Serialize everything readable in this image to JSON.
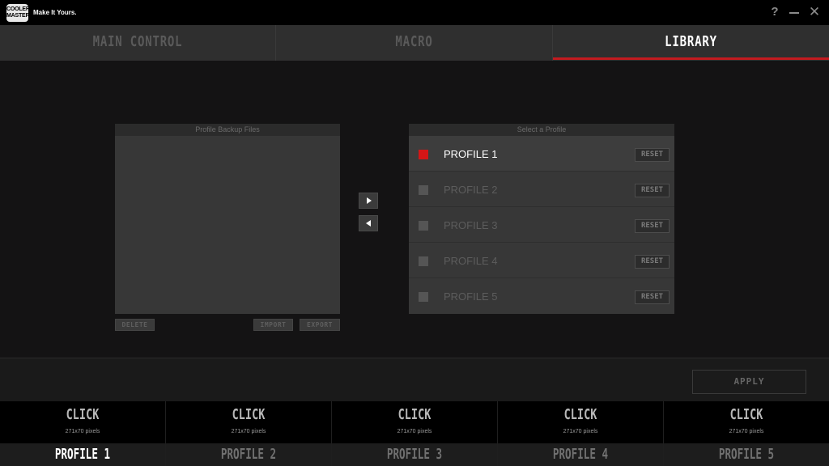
{
  "titlebar": {
    "logo_text": "COOLER MASTER",
    "tagline": "Make It Yours.",
    "help_label": "?",
    "close_label": "✕"
  },
  "tabs": [
    {
      "label": "MAIN CONTROL",
      "active": false
    },
    {
      "label": "MACRO",
      "active": false
    },
    {
      "label": "LIBRARY",
      "active": true
    }
  ],
  "colors": {
    "accent": "#c41a1f",
    "active_profile": "#d41616"
  },
  "backup_panel": {
    "title": "Profile Backup Files",
    "delete_label": "DELETE",
    "import_label": "IMPORT",
    "export_label": "EXPORT"
  },
  "select_panel": {
    "title": "Select a Profile",
    "profiles": [
      {
        "label": "PROFILE 1",
        "reset_label": "RESET",
        "active": true
      },
      {
        "label": "PROFILE 2",
        "reset_label": "RESET",
        "active": false
      },
      {
        "label": "PROFILE 3",
        "reset_label": "RESET",
        "active": false
      },
      {
        "label": "PROFILE 4",
        "reset_label": "RESET",
        "active": false
      },
      {
        "label": "PROFILE 5",
        "reset_label": "RESET",
        "active": false
      }
    ]
  },
  "apply_label": "APPLY",
  "profile_strip": [
    {
      "click": "CLICK",
      "size": "271x70 pixels",
      "name": "PROFILE 1",
      "active": true
    },
    {
      "click": "CLICK",
      "size": "271x70 pixels",
      "name": "PROFILE 2",
      "active": false
    },
    {
      "click": "CLICK",
      "size": "271x70 pixels",
      "name": "PROFILE 3",
      "active": false
    },
    {
      "click": "CLICK",
      "size": "271x70 pixels",
      "name": "PROFILE 4",
      "active": false
    },
    {
      "click": "CLICK",
      "size": "271x70 pixels",
      "name": "PROFILE 5",
      "active": false
    }
  ]
}
